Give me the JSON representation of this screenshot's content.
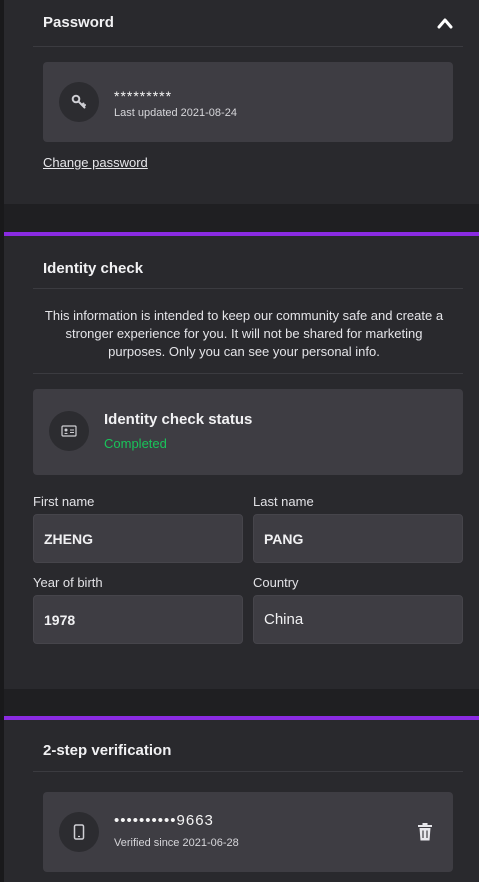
{
  "password": {
    "title": "Password",
    "masked": "*********",
    "last_updated": "Last updated 2021-08-24",
    "change_link": "Change password"
  },
  "identity": {
    "title": "Identity check",
    "info": "This information is intended to keep our community safe and create a stronger experience for you. It will not be shared for marketing purposes. Only you can see your personal info.",
    "status_title": "Identity check status",
    "status_value": "Completed",
    "status_color": "#19c35a",
    "fields": {
      "first_name_label": "First name",
      "first_name": "ZHENG",
      "last_name_label": "Last name",
      "last_name": "PANG",
      "year_label": "Year of birth",
      "year": "1978",
      "country_label": "Country",
      "country": "China"
    }
  },
  "two_step": {
    "title": "2-step verification",
    "phone_masked": "••••••••••9663",
    "verified": "Verified since 2021-06-28"
  },
  "accent_color": "#8a2be2"
}
